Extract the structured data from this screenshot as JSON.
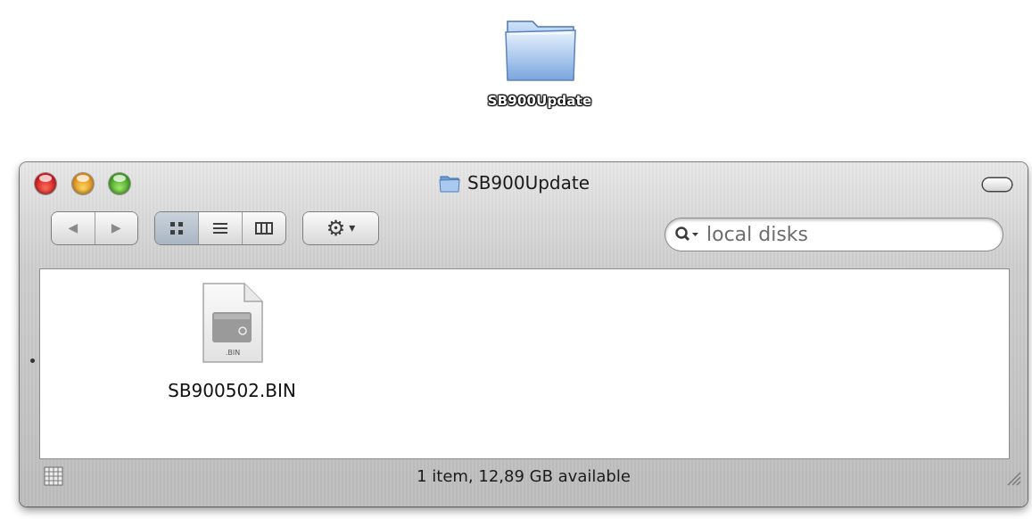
{
  "desktop": {
    "folder_label": "SB900Update"
  },
  "window": {
    "title": "SB900Update",
    "toolbar": {
      "back_glyph": "◀",
      "forward_glyph": "▶",
      "action_glyph": "⚙",
      "action_arrow": "▾"
    },
    "search": {
      "placeholder": "local disks"
    },
    "files": [
      {
        "name": "SB900502.BIN",
        "icon_tag": ".BIN"
      }
    ],
    "status": "1 item, 12,89 GB available"
  }
}
